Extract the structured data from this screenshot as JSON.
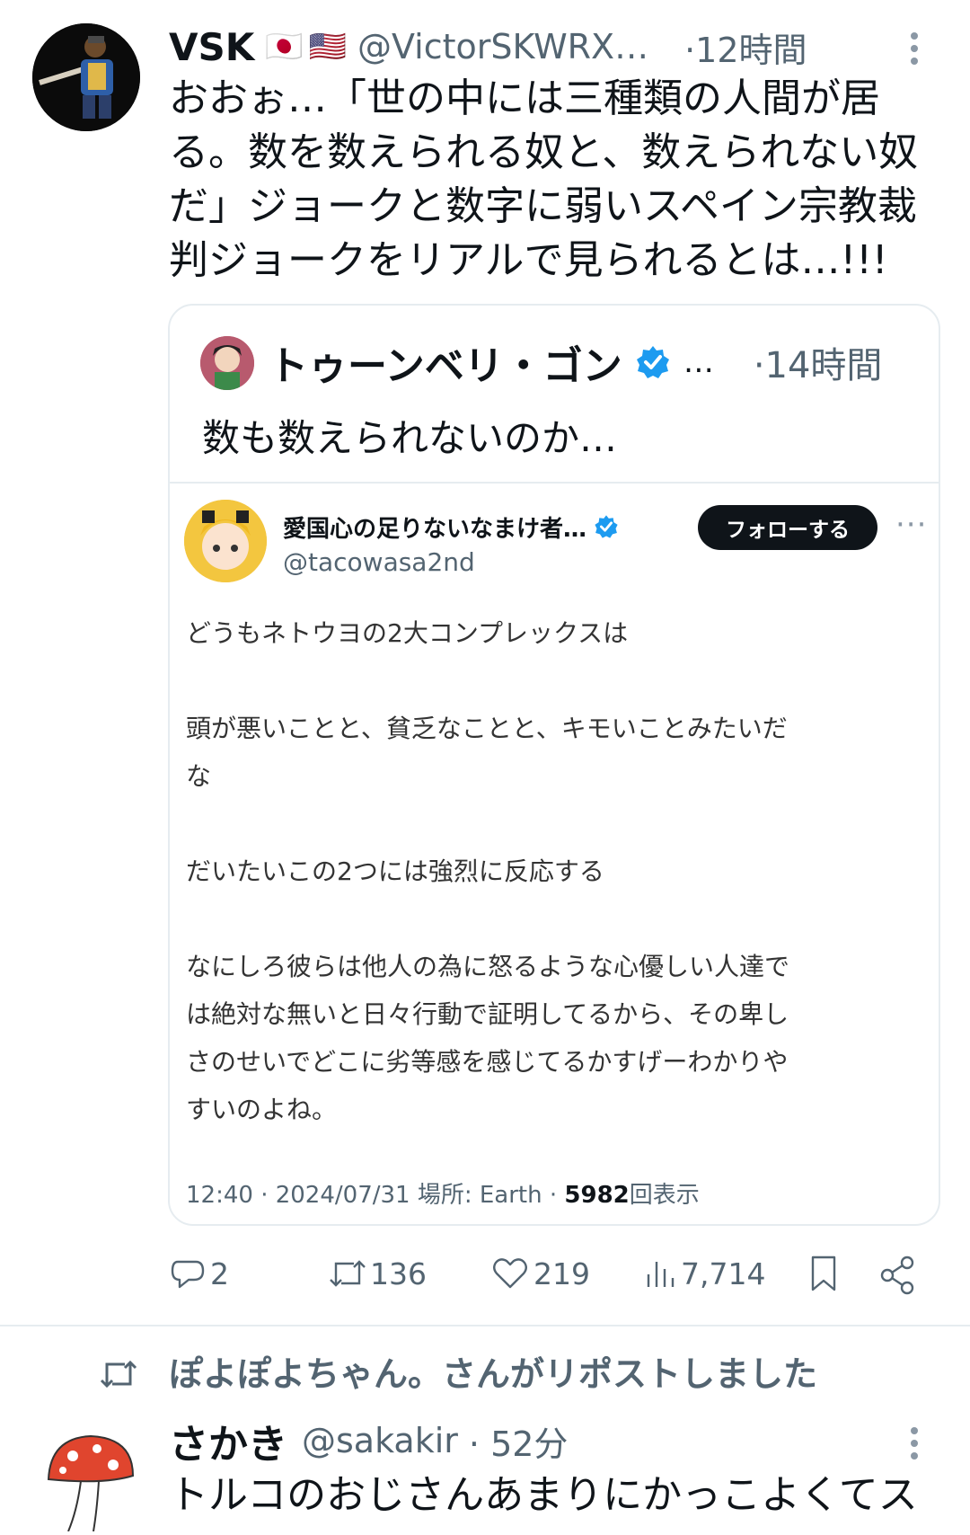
{
  "tweet": {
    "author_name": "VSK",
    "flags": [
      "🇯🇵",
      "🇺🇸"
    ],
    "handle": "@VictorSKWRX…",
    "time": "·12時間",
    "text_lines": [
      "おおぉ…「世の中には三種類の人間が居",
      "る。数を数えられる奴と、数えられない奴",
      "だ」ジョークと数字に弱いスペイン宗教裁",
      "判ジョークをリアルで見られるとは…!!!"
    ],
    "actions": {
      "replies": "2",
      "reposts": "136",
      "likes": "219",
      "views": "7,714"
    }
  },
  "quote": {
    "author_name": "トゥーンベリ・ゴン",
    "ellipsis": "…",
    "time": "·14時間",
    "text": "数も数えられないのか…",
    "embedded": {
      "author_name": "愛国心の足りないなまけ者…",
      "handle": "@tacowasa2nd",
      "follow_label": "フォローする",
      "more": "···",
      "paragraphs": [
        [
          "どうもネトウヨの2大コンプレックスは"
        ],
        [
          "頭が悪いことと、貧乏なことと、キモいことみたいだ",
          "な"
        ],
        [
          "だいたいこの2つには強烈に反応する"
        ],
        [
          "なにしろ彼らは他人の為に怒るような心優しい人達で",
          "は絶対な無いと日々行動で証明してるから、その卑し",
          "さのせいでどこに劣等感を感じてるかすげーわかりや",
          "すいのよね。"
        ]
      ],
      "meta_prefix": "12:40 · 2024/07/31 場所: Earth · ",
      "meta_views": "5982",
      "meta_suffix": "回表示"
    }
  },
  "repost_banner": "ぽよぽよちゃん。さんがリポストしました",
  "next_tweet": {
    "author_name": "さかき",
    "handle": "@sakakir",
    "time": "· 52分",
    "text": "トルコのおじさんあまりにかっこよくてス"
  },
  "colors": {
    "verified": "#1d9bf0",
    "text": "#0f1419",
    "secondary": "#536471",
    "border": "#e6ecf0"
  },
  "icons": [
    "more-icon",
    "verified-icon",
    "reply-icon",
    "repost-icon",
    "like-icon",
    "views-icon",
    "bookmark-icon",
    "share-icon"
  ]
}
